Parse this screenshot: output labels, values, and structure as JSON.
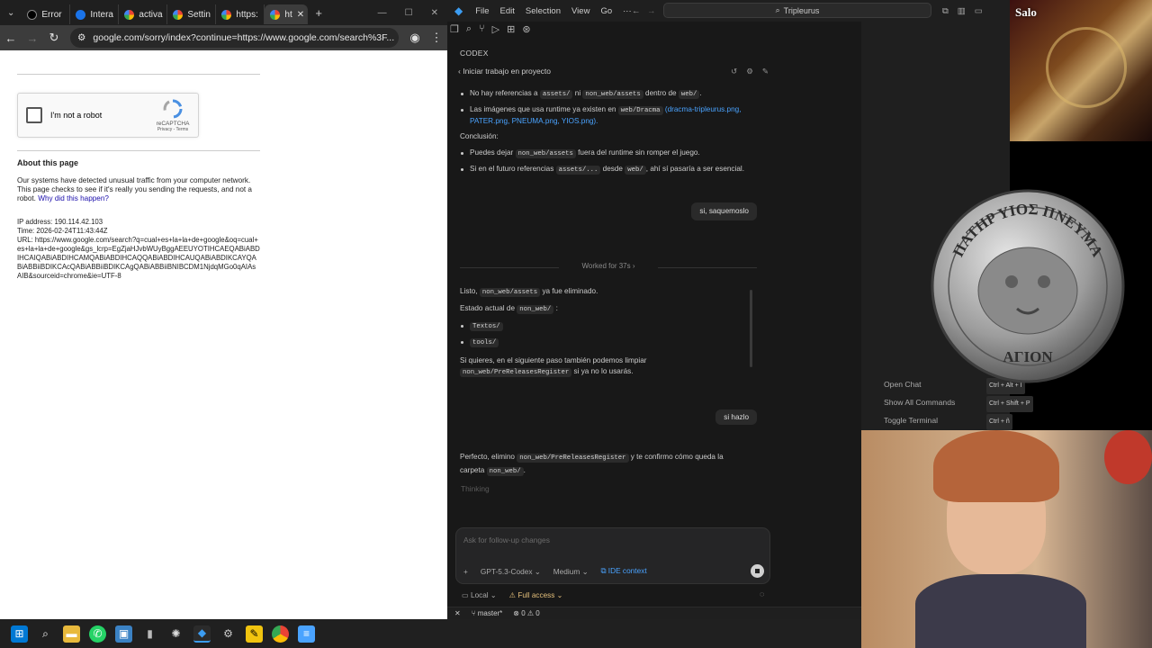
{
  "browser": {
    "tabs": [
      {
        "label": "Error",
        "color": "#000000"
      },
      {
        "label": "Intera",
        "color": "#1a73e8"
      },
      {
        "label": "activa",
        "color": "#ffffff"
      },
      {
        "label": "Settin",
        "color": "#ffffff"
      },
      {
        "label": "https:",
        "color": "#ffffff"
      },
      {
        "label": "ht",
        "color": "#ffffff"
      }
    ],
    "new_tab": "+",
    "url": "google.com/sorry/index?continue=https://www.google.com/search%3F..."
  },
  "captcha": {
    "checkbox_label": "I'm not a robot",
    "brand": "reCAPTCHA",
    "links": "Privacy - Terms"
  },
  "about": {
    "heading": "About this page",
    "text": "Our systems have detected unusual traffic from your computer network. This page checks to see if it's really you sending the requests, and not a robot.",
    "link": "Why did this happen?"
  },
  "info": {
    "ip": "IP address: 190.114.42.103",
    "time": "Time: 2026-02-24T11:43:44Z",
    "url": "URL: https://www.google.com/search?q=cual+es+la+la+de+google&oq=cual+es+la+la+de+google&gs_lcrp=EgZjaHJvbWUyBggAEEUYOTIHCAEQABiABDIHCAIQABiABDIHCAMQABiABDIHCAQQABiABDIHCAUQABiABDIKCAYQABiABBiiBDIKCAcQABiABBiiBDIKCAgQABiABBiiBNIBCDM1NjdqMGo0qAIAsAIB&sourceid=chrome&ie=UTF-8"
  },
  "vscode": {
    "menu": [
      "File",
      "Edit",
      "Selection",
      "View",
      "Go",
      "···"
    ],
    "search": "Tripleurus",
    "panel_title": "CODEX",
    "project_row": "Iniciar trabajo en proyecto",
    "msg1": {
      "b1_pre": "No hay referencias a",
      "b1_code1": "assets/",
      "b1_mid": "ni",
      "b1_code2": "non_web/assets",
      "b1_mid2": "dentro de",
      "b1_code3": "web/",
      "b1_end": ".",
      "b2_pre": "Las imágenes que usa runtime ya existen en",
      "b2_code": "web/Dracma",
      "b2_links": "(dracma-tripleurus.png, PATER.png, PNEUMA.png, YIOS.png).",
      "conclusion": "Conclusión:",
      "b3_pre": "Puedes dejar",
      "b3_code": "non_web/assets",
      "b3_end": "fuera del runtime sin romper el juego.",
      "b4_pre": "Si en el futuro referencias",
      "b4_code1": "assets/...",
      "b4_mid": "desde",
      "b4_code2": "web/",
      "b4_end": ", ahí sí pasaría a ser esencial."
    },
    "user1": "si, saquemoslo",
    "worked": "Worked for 37s  ›",
    "msg2": {
      "l1_pre": "Listo,",
      "l1_code": "non_web/assets",
      "l1_end": "ya fue eliminado.",
      "l2_pre": "Estado actual de",
      "l2_code": "non_web/",
      "l2_end": ":",
      "items": [
        "Textos/",
        "tools/"
      ],
      "l3": "Si quieres, en el siguiente paso también podemos limpiar",
      "l3_code": "non_web/PreReleasesRegister",
      "l3_end": "si ya no lo usarás."
    },
    "user2": "si hazlo",
    "msg3": {
      "pre": "Perfecto, elimino",
      "code1": "non_web/PreReleasesRegister",
      "mid": "y te confirmo cómo queda la carpeta",
      "code2": "non_web/",
      "end": "."
    },
    "thinking": "Thinking",
    "input_placeholder": "Ask for follow-up changes",
    "model": "GPT-5.3-Codex ⌄",
    "effort": "Medium ⌄",
    "ide_context": "IDE context",
    "env_local": "Local ⌄",
    "env_access": "Full access ⌄",
    "status_branch": "master*",
    "status_problems": "⊗ 0  ⚠ 0",
    "shortcuts": [
      {
        "label": "Open Chat",
        "keys": "Ctrl + Alt + I"
      },
      {
        "label": "Show All Commands",
        "keys": "Ctrl + Shift + P"
      },
      {
        "label": "Toggle Terminal",
        "keys": "Ctrl + ñ"
      }
    ]
  },
  "overlay": {
    "coin_text_top": "ΠΑΤΗΡ ΥΙΟΣ ΠΝΕΥΜΑ",
    "coin_text_bottom": "ΑΓΙΟΝ",
    "book_badge": "Salo"
  }
}
